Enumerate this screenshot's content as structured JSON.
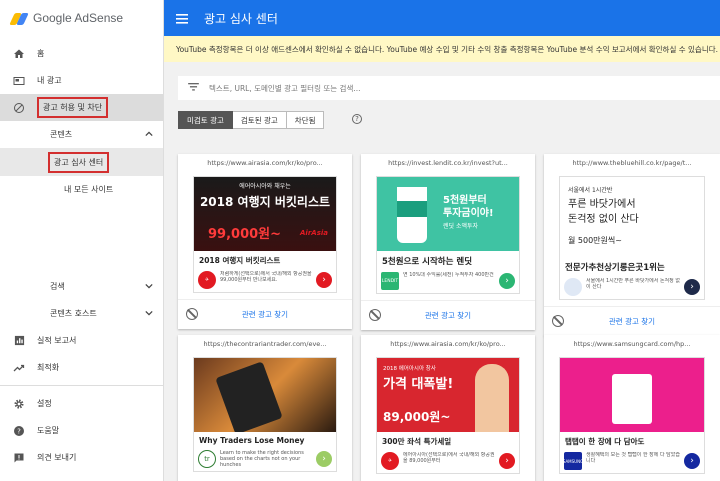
{
  "app": {
    "logo_text": "Google AdSense",
    "page_title": "광고 심사 센터"
  },
  "banner": "YouTube 측정항목은 더 이상 애드센스에서 확인하실 수 없습니다. YouTube 예상 수입 및 기타 수익 창출 측정항목은 YouTube 분석 수익 보고서에서 확인하실 수 있습니다.",
  "sidebar": {
    "items": [
      {
        "label": "홈",
        "icon": "home-icon"
      },
      {
        "label": "내 광고",
        "icon": "ads-icon"
      },
      {
        "label": "광고 허용 및 차단",
        "icon": "block-icon"
      },
      {
        "label": "콘텐츠"
      },
      {
        "label": "광고 심사 센터"
      },
      {
        "label": "내 모든 사이트"
      },
      {
        "label": "검색"
      },
      {
        "label": "콘텐츠 호스트"
      },
      {
        "label": "실적 보고서",
        "icon": "bar-chart-icon"
      },
      {
        "label": "최적화",
        "icon": "trending-icon"
      },
      {
        "label": "설정",
        "icon": "gear-icon"
      },
      {
        "label": "도움말",
        "icon": "help-icon"
      },
      {
        "label": "의견 보내기",
        "icon": "feedback-icon"
      }
    ]
  },
  "filter": {
    "placeholder": "텍스트, URL, 도메인별 광고 필터링 또는 검색..."
  },
  "tabs": [
    "미검토 광고",
    "검토된 광고",
    "차단됨"
  ],
  "help_glyph": "?",
  "related_label": "관련 광고 찾기",
  "cards": [
    {
      "url": "https://www.airasia.com/kr/ko/pro...",
      "img_lines": [
        "에어아시아와 채우는",
        "2018 여행지 버킷리스트",
        "99,000원~"
      ],
      "brand": "AirAsia",
      "title": "2018 여행지 버킷리스트",
      "desc": "저렴하게(선택으로)에서 국내/해외 항공권을 99,000원부터 만나보세요."
    },
    {
      "url": "https://invest.lendit.co.kr/invest?ut...",
      "img_lines": [
        "5천원부터",
        "투자금이야!",
        "렌딧 소액투자"
      ],
      "brand": "LENDIT",
      "title": "5천원으로 시작하는 렌딧",
      "desc": "연 10%대 수익률(세전) 누적투자 400만건"
    },
    {
      "url": "http://www.thebluehill.co.kr/page/t...",
      "img_lines": [
        "서울에서 1시간반",
        "푸른 바닷가에서",
        "돈걱정 없이 산다",
        "월 500만원씩~"
      ],
      "brand": "",
      "title": "전문가추천상기롱은곳1위는",
      "desc": "서울에서 1시간반 푸른 바닷가에서 돈걱정 없이 산다"
    },
    {
      "url": "https://thecontrariantrader.com/eve...",
      "img_lines": [],
      "brand": "tr",
      "title": "Why Traders Lose Money",
      "desc": "Learn to make the right decisions based on the charts not on your hunches"
    },
    {
      "url": "https://www.airasia.com/kr/ko/pro...",
      "img_lines": [
        "2018 에어아시아 창사",
        "가격 대폭발!",
        "89,000원~"
      ],
      "brand": "AirAsia",
      "title": "300만 좌석 특가세일",
      "desc": "에어아시아(선택으로)에서 국내/해외 항공권을 89,000원부터"
    },
    {
      "url": "https://www.samsungcard.com/hp...",
      "img_lines": [],
      "brand": "SAMSUNG",
      "title": "탭탭이 한 장에 다 담아도",
      "desc": "생활혜택의 모든 것 탭탭이 한 장에 다 담았습니다"
    }
  ],
  "colors": {
    "header": "#1a73e8",
    "airasia": "#e21a22",
    "lendit": "#2bb673",
    "samsung": "#1428a0"
  }
}
